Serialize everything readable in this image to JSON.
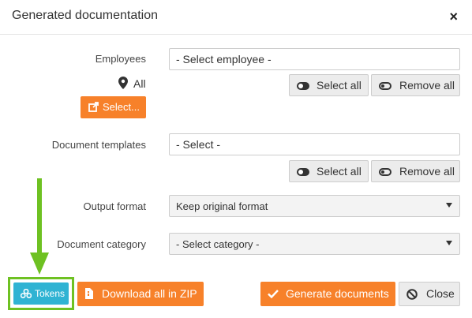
{
  "dialog": {
    "title": "Generated documentation",
    "close_glyph": "×"
  },
  "employees": {
    "label": "Employees",
    "value": "- Select employee -",
    "location_text": "All",
    "select_button": "Select...",
    "select_all": "Select all",
    "remove_all": "Remove all"
  },
  "templates": {
    "label": "Document templates",
    "value": "- Select -",
    "select_all": "Select all",
    "remove_all": "Remove all"
  },
  "output_format": {
    "label": "Output format",
    "value": "Keep original format"
  },
  "category": {
    "label": "Document category",
    "value": "- Select category -"
  },
  "footer": {
    "tokens": "Tokens",
    "download_zip": "Download all in ZIP",
    "generate": "Generate documents",
    "close": "Close"
  },
  "colors": {
    "accent": "#f7812a",
    "tokens": "#2fb3d3",
    "highlight": "#6ec122"
  },
  "icons": [
    "close-icon",
    "map-marker-icon",
    "external-link-icon",
    "toggle-on-icon",
    "toggle-off-icon",
    "caret-down-icon",
    "arrow-down-icon",
    "tokens-icon",
    "zip-file-icon",
    "check-icon",
    "ban-icon"
  ]
}
